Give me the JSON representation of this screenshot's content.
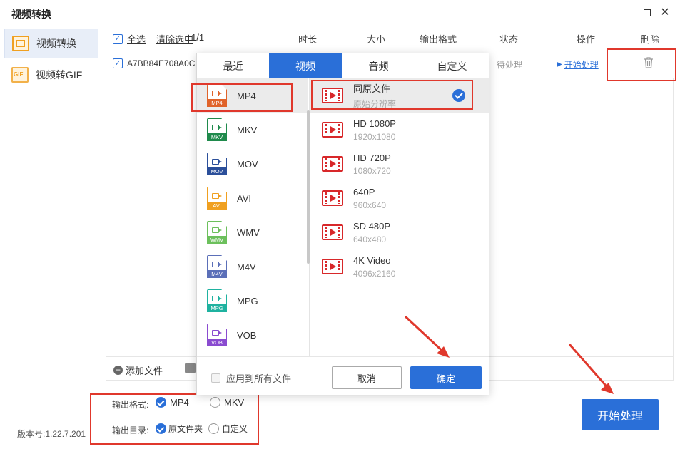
{
  "app": {
    "title": "视频转换"
  },
  "sidebar": {
    "items": [
      {
        "label": "视频转换",
        "icon": "convert-icon",
        "active": true
      },
      {
        "label": "视频转GIF",
        "icon": "gif-icon",
        "active": false
      }
    ],
    "version": "版本号:1.22.7.201"
  },
  "list": {
    "select_all": "全选",
    "clear_selected": "清除选中",
    "count": "1/1",
    "columns": [
      "时长",
      "大小",
      "输出格式",
      "状态",
      "操作",
      "删除"
    ],
    "rows": [
      {
        "name": "A7BB84E708A0C",
        "status": "待处理",
        "action": "开始处理"
      }
    ],
    "add_file": "添加文件"
  },
  "popup": {
    "tabs": [
      "最近",
      "视频",
      "音频",
      "自定义"
    ],
    "active_tab": "视频",
    "formats": [
      {
        "name": "MP4",
        "color": "#e0632a",
        "selected": true
      },
      {
        "name": "MKV",
        "color": "#1f8a4c"
      },
      {
        "name": "MOV",
        "color": "#2b4f9a"
      },
      {
        "name": "AVI",
        "color": "#f0a020"
      },
      {
        "name": "WMV",
        "color": "#6cc05c"
      },
      {
        "name": "M4V",
        "color": "#5b6fb8"
      },
      {
        "name": "MPG",
        "color": "#1fb2a0"
      },
      {
        "name": "VOB",
        "color": "#8a4bd0"
      }
    ],
    "resolutions": [
      {
        "name": "同原文件",
        "sub": "原始分辨率",
        "selected": true
      },
      {
        "name": "HD 1080P",
        "sub": "1920x1080"
      },
      {
        "name": "HD 720P",
        "sub": "1080x720"
      },
      {
        "name": "640P",
        "sub": "960x640"
      },
      {
        "name": "SD 480P",
        "sub": "640x480"
      },
      {
        "name": "4K Video",
        "sub": "4096x2160"
      }
    ],
    "apply_all": "应用到所有文件",
    "cancel": "取消",
    "confirm": "确定"
  },
  "output": {
    "format_label": "输出格式:",
    "format_options": [
      {
        "label": "MP4",
        "checked": true
      },
      {
        "label": "MKV",
        "checked": false
      }
    ],
    "dir_label": "输出目录:",
    "dir_options": [
      {
        "label": "原文件夹",
        "checked": true
      },
      {
        "label": "自定义",
        "checked": false
      }
    ]
  },
  "start_button": "开始处理",
  "colors": {
    "accent": "#2a6fd8",
    "highlight": "#e0382c"
  }
}
